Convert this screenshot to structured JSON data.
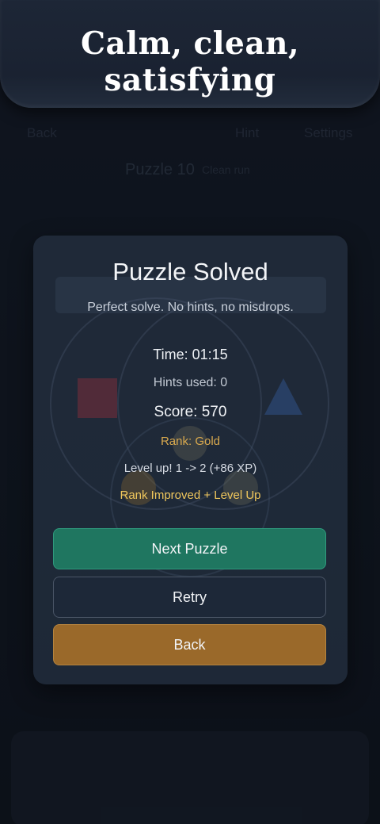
{
  "caption": {
    "text": "Calm, clean, satisfying"
  },
  "topbar": {
    "back": "Back",
    "hint": "Hint",
    "settings": "Settings"
  },
  "puzzle": {
    "title": "Puzzle 10",
    "tag": "Clean run"
  },
  "modal": {
    "title": "Puzzle Solved",
    "subtitle": "Perfect solve. No hints, no misdrops.",
    "time": "Time: 01:15",
    "hints_used": "Hints used: 0",
    "score": "Score: 570",
    "rank": "Rank: Gold",
    "level_up": "Level up! 1 -> 2 (+86 XP)",
    "status": "Rank Improved + Level Up",
    "buttons": {
      "next": "Next Puzzle",
      "retry": "Retry",
      "back": "Back"
    }
  },
  "colors": {
    "next_button": "#1f7660",
    "retry_button": "#1d2838",
    "back_button": "#9a692a",
    "rank_gold": "#d9a94e",
    "status_gold": "#f0c75c"
  }
}
